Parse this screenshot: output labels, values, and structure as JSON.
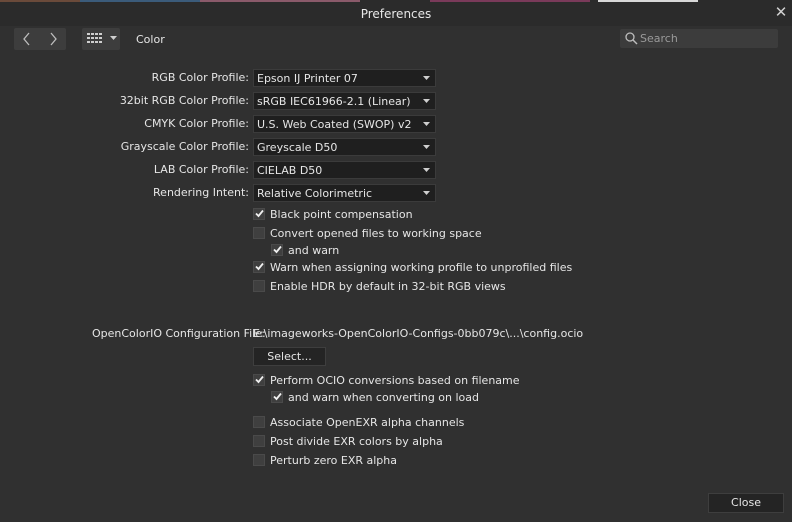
{
  "window": {
    "title": "Preferences"
  },
  "toolbar": {
    "back_icon": "chevron-left-icon",
    "forward_icon": "chevron-right-icon",
    "grid_icon": "grid-icon",
    "section_title": "Color",
    "search_placeholder": "Search",
    "search_value": ""
  },
  "profiles": [
    {
      "label": "RGB Color Profile:",
      "value": "Epson IJ Printer 07"
    },
    {
      "label": "32bit RGB Color Profile:",
      "value": "sRGB IEC61966-2.1 (Linear)"
    },
    {
      "label": "CMYK Color Profile:",
      "value": "U.S. Web Coated (SWOP) v2"
    },
    {
      "label": "Grayscale Color Profile:",
      "value": "Greyscale D50"
    },
    {
      "label": "LAB Color Profile:",
      "value": "CIELAB D50"
    },
    {
      "label": "Rendering Intent:",
      "value": "Relative Colorimetric"
    }
  ],
  "options": [
    {
      "label": "Black point compensation",
      "checked": true
    },
    {
      "label": "Convert opened files to working space",
      "checked": false
    },
    {
      "label": "and warn",
      "checked": true
    },
    {
      "label": "Warn when assigning working profile to unprofiled files",
      "checked": true
    },
    {
      "label": "Enable HDR by default in 32-bit RGB views",
      "checked": false
    }
  ],
  "ocio": {
    "label": "OpenColorIO Configuration File:",
    "path": "E:\\imageworks-OpenColorIO-Configs-0bb079c\\...\\config.ocio",
    "select_label": "Select..."
  },
  "ocio_options": [
    {
      "label": "Perform OCIO conversions based on filename",
      "checked": true
    },
    {
      "label": "and warn when converting on load",
      "checked": true
    },
    {
      "label": "Associate OpenEXR alpha channels",
      "checked": false
    },
    {
      "label": "Post divide EXR colors by alpha",
      "checked": false
    },
    {
      "label": "Perturb zero EXR alpha",
      "checked": false
    }
  ],
  "footer": {
    "close_label": "Close"
  },
  "colors": {
    "background": "#303030",
    "titlebar": "#2b2b2b",
    "field": "#1f1f1f",
    "text": "#e6e6e6"
  }
}
